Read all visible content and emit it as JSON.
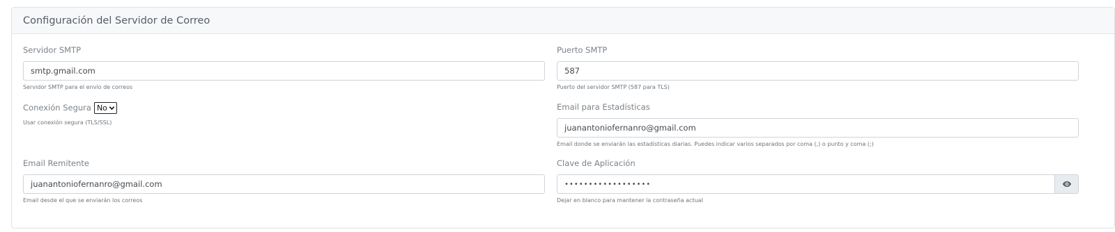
{
  "card": {
    "title": "Configuración del Servidor de Correo"
  },
  "smtp_server": {
    "label": "Servidor SMTP",
    "value": "smtp.gmail.com",
    "help": "Servidor SMTP para el envío de correos"
  },
  "smtp_port": {
    "label": "Puerto SMTP",
    "value": "587",
    "help": "Puerto del servidor SMTP (587 para TLS)"
  },
  "secure_connection": {
    "label": "Conexión Segura",
    "selected": "No",
    "help": "Usar conexión segura (TLS/SSL)"
  },
  "stats_email": {
    "label": "Email para Estadísticas",
    "value": "juanantoniofernanro@gmail.com",
    "help": "Email donde se enviarán las estadísticas diarias. Puedes indicar varios separados por coma (,) o punto y coma (;)"
  },
  "sender_email": {
    "label": "Email Remitente",
    "value": "juanantoniofernanro@gmail.com",
    "help": "Email desde el que se enviarán los correos"
  },
  "app_password": {
    "label": "Clave de Aplicación",
    "masked_value": "••••••••••••••••••",
    "toggle_icon": "eye-icon",
    "help": "Dejar en blanco para mantener la contraseña actual"
  },
  "colors": {
    "header_bg": "#f7f8fa",
    "border": "#ced4da",
    "addon_bg": "#e9ecef"
  }
}
